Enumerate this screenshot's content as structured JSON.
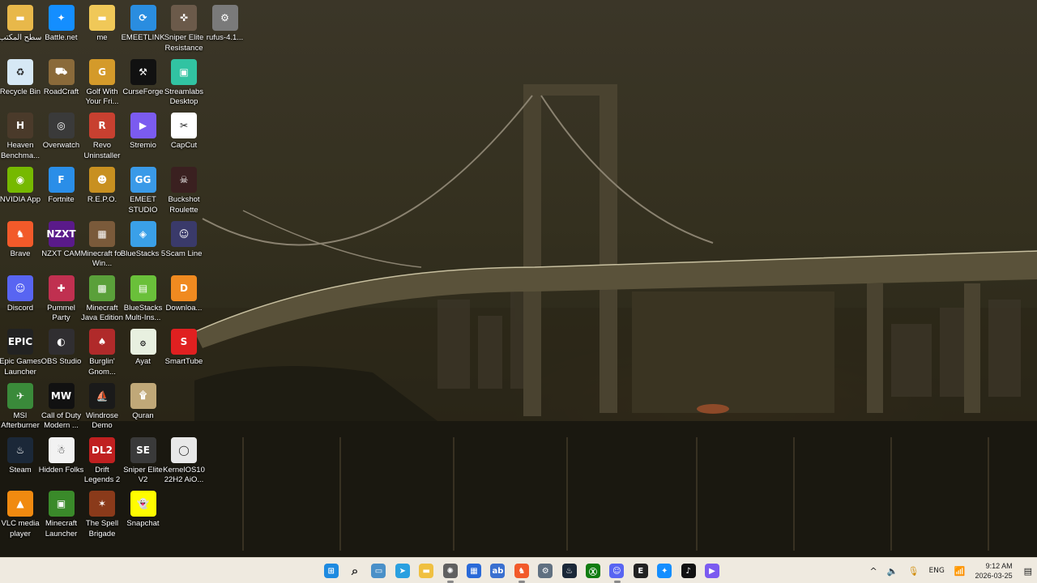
{
  "desktop": {
    "icons": [
      {
        "label": "سطح المكتب",
        "icon": "folder-icon",
        "bg": "#e8b84a",
        "glyph": "▬"
      },
      {
        "label": "Battle.net",
        "icon": "battlenet-icon",
        "bg": "#148eff",
        "glyph": "✦"
      },
      {
        "label": "me",
        "icon": "folder-icon",
        "bg": "#f0c858",
        "glyph": "▬"
      },
      {
        "label": "EMEETLINK",
        "icon": "emeetlink-icon",
        "bg": "#2a8de0",
        "glyph": "⟳"
      },
      {
        "label": "Sniper Elite Resistance",
        "icon": "sniper-elite-resistance-icon",
        "bg": "#6b5a4a",
        "glyph": "✜"
      },
      {
        "label": "rufus-4.1...",
        "icon": "rufus-icon",
        "bg": "#7a7a7a",
        "glyph": "⚙"
      },
      {
        "label": "Recycle Bin",
        "icon": "recycle-bin-icon",
        "bg": "#d6e8f5",
        "glyph": "♻"
      },
      {
        "label": "RoadCraft",
        "icon": "roadcraft-icon",
        "bg": "#8a6a3a",
        "glyph": "⛟"
      },
      {
        "label": "Golf With Your Fri...",
        "icon": "golf-icon",
        "bg": "#d49a2a",
        "glyph": "G"
      },
      {
        "label": "CurseForge",
        "icon": "curseforge-icon",
        "bg": "#111111",
        "glyph": "⚒"
      },
      {
        "label": "Streamlabs Desktop",
        "icon": "streamlabs-icon",
        "bg": "#31c3a2",
        "glyph": "▣"
      },
      {
        "label": "Heaven Benchma...",
        "icon": "heaven-benchmark-icon",
        "bg": "#4a3a2a",
        "glyph": "H"
      },
      {
        "label": "Overwatch",
        "icon": "overwatch-icon",
        "bg": "#3a3a3a",
        "glyph": "◎"
      },
      {
        "label": "Revo Uninstaller",
        "icon": "revo-uninstaller-icon",
        "bg": "#c84030",
        "glyph": "R"
      },
      {
        "label": "Stremio",
        "icon": "stremio-icon",
        "bg": "#7b5bf0",
        "glyph": "▶"
      },
      {
        "label": "CapCut",
        "icon": "capcut-icon",
        "bg": "#ffffff",
        "glyph": "✂"
      },
      {
        "label": "NVIDIA App",
        "icon": "nvidia-icon",
        "bg": "#76b900",
        "glyph": "◉"
      },
      {
        "label": "Fortnite",
        "icon": "fortnite-icon",
        "bg": "#2a8ee8",
        "glyph": "F"
      },
      {
        "label": "R.E.P.O.",
        "icon": "repo-icon",
        "bg": "#c89020",
        "glyph": "☻"
      },
      {
        "label": "EMEET STUDIO",
        "icon": "emeet-studio-icon",
        "bg": "#3a9ae8",
        "glyph": "GG"
      },
      {
        "label": "Buckshot Roulette",
        "icon": "buckshot-roulette-icon",
        "bg": "#3a2020",
        "glyph": "☠"
      },
      {
        "label": "Brave",
        "icon": "brave-icon",
        "bg": "#f25a2a",
        "glyph": "♞"
      },
      {
        "label": "NZXT CAM",
        "icon": "nzxt-cam-icon",
        "bg": "#5a1a8a",
        "glyph": "NZXT"
      },
      {
        "label": "Minecraft for Win...",
        "icon": "minecraft-windows-icon",
        "bg": "#7a5a3a",
        "glyph": "▦"
      },
      {
        "label": "BlueStacks 5",
        "icon": "bluestacks-icon",
        "bg": "#3aa0e8",
        "glyph": "◈"
      },
      {
        "label": "Scam Line",
        "icon": "scam-line-icon",
        "bg": "#3a3a6a",
        "glyph": "☺"
      },
      {
        "label": "Discord",
        "icon": "discord-icon",
        "bg": "#5865f2",
        "glyph": "☺"
      },
      {
        "label": "Pummel Party",
        "icon": "pummel-party-icon",
        "bg": "#c03050",
        "glyph": "✚"
      },
      {
        "label": "Minecraft Java Edition",
        "icon": "minecraft-java-icon",
        "bg": "#5aa03a",
        "glyph": "▩"
      },
      {
        "label": "BlueStacks Multi-Ins...",
        "icon": "bluestacks-multi-icon",
        "bg": "#6ac03a",
        "glyph": "▤"
      },
      {
        "label": "Downloa...",
        "icon": "download-icon",
        "bg": "#f08a20",
        "glyph": "D"
      },
      {
        "label": "Epic Games Launcher",
        "icon": "epic-games-icon",
        "bg": "#222222",
        "glyph": "EPIC"
      },
      {
        "label": "OBS Studio",
        "icon": "obs-icon",
        "bg": "#302e31",
        "glyph": "◐"
      },
      {
        "label": "Burglin' Gnom...",
        "icon": "burglin-gnomes-icon",
        "bg": "#b02a2a",
        "glyph": "♠"
      },
      {
        "label": "Ayat",
        "icon": "ayat-icon",
        "bg": "#e8f0e0",
        "glyph": "۞"
      },
      {
        "label": "SmartTube",
        "icon": "smarttube-icon",
        "bg": "#e02020",
        "glyph": "S"
      },
      {
        "label": "MSI Afterburner",
        "icon": "msi-afterburner-icon",
        "bg": "#3a8a3a",
        "glyph": "✈"
      },
      {
        "label": "Call of Duty Modern ...",
        "icon": "call-of-duty-icon",
        "bg": "#111111",
        "glyph": "MW"
      },
      {
        "label": "Windrose Demo",
        "icon": "windrose-icon",
        "bg": "#1a1a1a",
        "glyph": "⛵"
      },
      {
        "label": "Quran",
        "icon": "quran-icon",
        "bg": "#c0a878",
        "glyph": "۩"
      },
      {
        "label": "Steam",
        "icon": "steam-icon",
        "bg": "#1b2838",
        "glyph": "♨"
      },
      {
        "label": "Hidden Folks",
        "icon": "hidden-folks-icon",
        "bg": "#f2f2f2",
        "glyph": "☃"
      },
      {
        "label": "Drift Legends 2",
        "icon": "drift-legends-icon",
        "bg": "#c02020",
        "glyph": "DL2"
      },
      {
        "label": "Sniper Elite V2",
        "icon": "sniper-elite-v2-icon",
        "bg": "#3a3a3a",
        "glyph": "SE"
      },
      {
        "label": "KernelOS10 22H2 AiO...",
        "icon": "disc-image-icon",
        "bg": "#e8e8e8",
        "glyph": "◯"
      },
      {
        "label": "VLC media player",
        "icon": "vlc-icon",
        "bg": "#f08a10",
        "glyph": "▲"
      },
      {
        "label": "Minecraft Launcher",
        "icon": "minecraft-launcher-icon",
        "bg": "#3a8a2a",
        "glyph": "▣"
      },
      {
        "label": "The Spell Brigade",
        "icon": "spell-brigade-icon",
        "bg": "#8a3a1a",
        "glyph": "✶"
      },
      {
        "label": "Snapchat",
        "icon": "snapchat-icon",
        "bg": "#fffc00",
        "glyph": "👻"
      }
    ]
  },
  "taskbar": {
    "apps": [
      {
        "name": "start",
        "icon": "windows-start-icon",
        "bg": "#1e8ae0",
        "glyph": "⊞",
        "active": false
      },
      {
        "name": "search",
        "icon": "search-icon",
        "bg": "transparent",
        "glyph": "⌕",
        "active": false
      },
      {
        "name": "widgets",
        "icon": "widgets-icon",
        "bg": "#4a90c8",
        "glyph": "▭",
        "active": false
      },
      {
        "name": "telegram",
        "icon": "telegram-icon",
        "bg": "#2aa0e0",
        "glyph": "➤",
        "active": false
      },
      {
        "name": "file-explorer",
        "icon": "folder-icon",
        "bg": "#f0c040",
        "glyph": "▬",
        "active": false
      },
      {
        "name": "chatgpt",
        "icon": "chatgpt-icon",
        "bg": "#606060",
        "glyph": "✺",
        "active": true
      },
      {
        "name": "ms-store",
        "icon": "store-icon",
        "bg": "#2a6ad8",
        "glyph": "▦",
        "active": false
      },
      {
        "name": "app-blue",
        "icon": "app-circle-icon",
        "bg": "#3a70d0",
        "glyph": "ab",
        "active": false
      },
      {
        "name": "brave",
        "icon": "brave-icon",
        "bg": "#f25a2a",
        "glyph": "♞",
        "active": true
      },
      {
        "name": "settings",
        "icon": "settings-icon",
        "bg": "#607080",
        "glyph": "⚙",
        "active": false
      },
      {
        "name": "steam",
        "icon": "steam-icon",
        "bg": "#1b2838",
        "glyph": "♨",
        "active": false
      },
      {
        "name": "xbox",
        "icon": "xbox-icon",
        "bg": "#107c10",
        "glyph": "Ⓧ",
        "active": false
      },
      {
        "name": "discord",
        "icon": "discord-icon",
        "bg": "#5865f2",
        "glyph": "☺",
        "active": true
      },
      {
        "name": "epic",
        "icon": "epic-games-icon",
        "bg": "#222222",
        "glyph": "E",
        "active": false
      },
      {
        "name": "battlenet",
        "icon": "battlenet-icon",
        "bg": "#148eff",
        "glyph": "✦",
        "active": false
      },
      {
        "name": "tiktok",
        "icon": "tiktok-icon",
        "bg": "#111111",
        "glyph": "♪",
        "active": false
      },
      {
        "name": "stremio",
        "icon": "stremio-icon",
        "bg": "#7b5bf0",
        "glyph": "▶",
        "active": false
      }
    ],
    "tray": {
      "chevron": "^",
      "speaker": "🔈",
      "mic": "🎙",
      "lang": "ENG",
      "network": "📶",
      "time": "9:12 AM",
      "date": "2026-03-25",
      "notification": "▤"
    }
  }
}
